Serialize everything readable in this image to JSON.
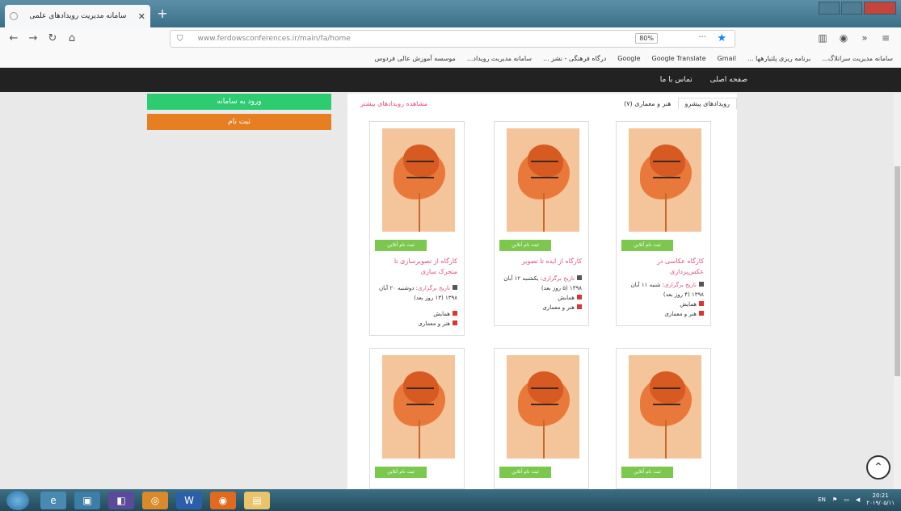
{
  "browser": {
    "tab_title": "سامانه مدیریت رویدادهای علمی",
    "url": "www.ferdowsconferences.ir/main/fa/home",
    "zoom": "80%",
    "bookmarks": [
      "سامانه مدیریت سرانلاگ...",
      "برنامه ریزی پلتیارهها ...",
      "Gmail",
      "Google Translate",
      "Google",
      "درگاه فرهنگی - نشر ...",
      "سامانه مدیریت رویداد...",
      "موسسه آموزش عالی فردوس"
    ]
  },
  "site_nav": {
    "items": [
      "صفحه اصلی",
      "تماس با ما"
    ]
  },
  "sidebar": {
    "green_button": "ورود به سامانه",
    "orange_button": "ثبت نام"
  },
  "tabs": {
    "active": "رویدادهای پیشرو",
    "second": "هنر و معماری (۷)",
    "pink_link": "مشاهده رویدادهای بیشتر"
  },
  "cards": [
    {
      "register": "ثبت نام آنلاین",
      "title": "کارگاه عکاسی در عکس‌پردازی",
      "date_link": "تاریخ برگزاری",
      "date_text": ": شنبه ۱۱ آبان ۱۳۹۸ (۴ روز بعد)",
      "type": "همایش",
      "category": "هنر و معماری"
    },
    {
      "register": "ثبت نام آنلاین",
      "title": "کارگاه از ایده تا تصویر",
      "date_link": "تاریخ برگزاری",
      "date_text": ": یکشنبه ۱۲ آبان ۱۳۹۸ (۵ روز بعد)",
      "type": "همایش",
      "category": "هنر و معماری"
    },
    {
      "register": "ثبت نام آنلاین",
      "title": "کارگاه از تصویرسازی تا متحرک سازی",
      "date_link": "تاریخ برگزاری",
      "date_text": ": دوشنبه ۲۰ آبان ۱۳۹۸ (۱۳ روز بعد)",
      "type": "همایش",
      "category": "هنر و معماری"
    },
    {
      "register": "ثبت نام آنلاین"
    },
    {
      "register": "ثبت نام آنلاین"
    },
    {
      "register": "ثبت نام آنلاین"
    }
  ],
  "taskbar": {
    "lang": "EN",
    "time": "20:21",
    "date": "۲۰۱۹/۰۵/۱۱"
  }
}
